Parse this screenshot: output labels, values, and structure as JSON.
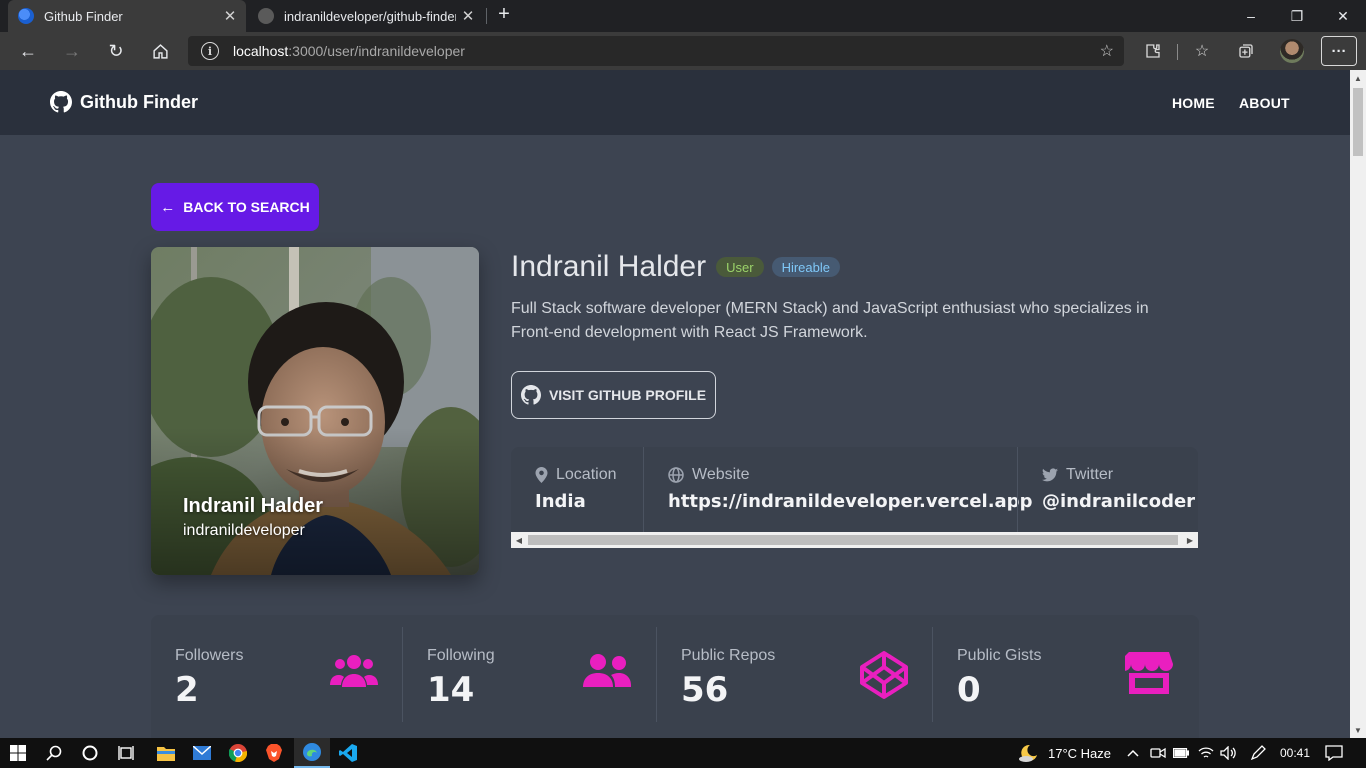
{
  "browser": {
    "tabs": [
      {
        "title": "Github Finder",
        "active": true
      },
      {
        "title": "indranildeveloper/github-finder-",
        "active": false
      }
    ],
    "url_host": "localhost",
    "url_rest": ":3000/user/indranildeveloper"
  },
  "navbar": {
    "brand": "Github Finder",
    "links": [
      "HOME",
      "ABOUT"
    ]
  },
  "profile": {
    "back_label": "BACK TO SEARCH",
    "name": "Indranil Halder",
    "login": "indranildeveloper",
    "badge_type": "User",
    "badge_hireable": "Hireable",
    "bio": "Full Stack software developer (MERN Stack) and JavaScript enthusiast who specializes in Front-end development with React JS Framework.",
    "visit_label": "VISIT GITHUB PROFILE",
    "info": [
      {
        "label": "Location",
        "value": "India",
        "icon": "map-pin-icon"
      },
      {
        "label": "Website",
        "value": "https://indranildeveloper.vercel.app",
        "icon": "globe-icon"
      },
      {
        "label": "Twitter",
        "value": "@indranilcoder",
        "icon": "twitter-icon"
      }
    ]
  },
  "stats": [
    {
      "label": "Followers",
      "value": "2",
      "icon": "users-icon"
    },
    {
      "label": "Following",
      "value": "14",
      "icon": "user-friends-icon"
    },
    {
      "label": "Public Repos",
      "value": "56",
      "icon": "codepen-icon"
    },
    {
      "label": "Public Gists",
      "value": "0",
      "icon": "store-icon"
    }
  ],
  "colors": {
    "primary": "#661ae6",
    "accent": "#e91fbf",
    "navbar": "#2a303c",
    "background": "#3d4451"
  },
  "taskbar": {
    "weather": "17°C  Haze",
    "time": "00:41"
  }
}
